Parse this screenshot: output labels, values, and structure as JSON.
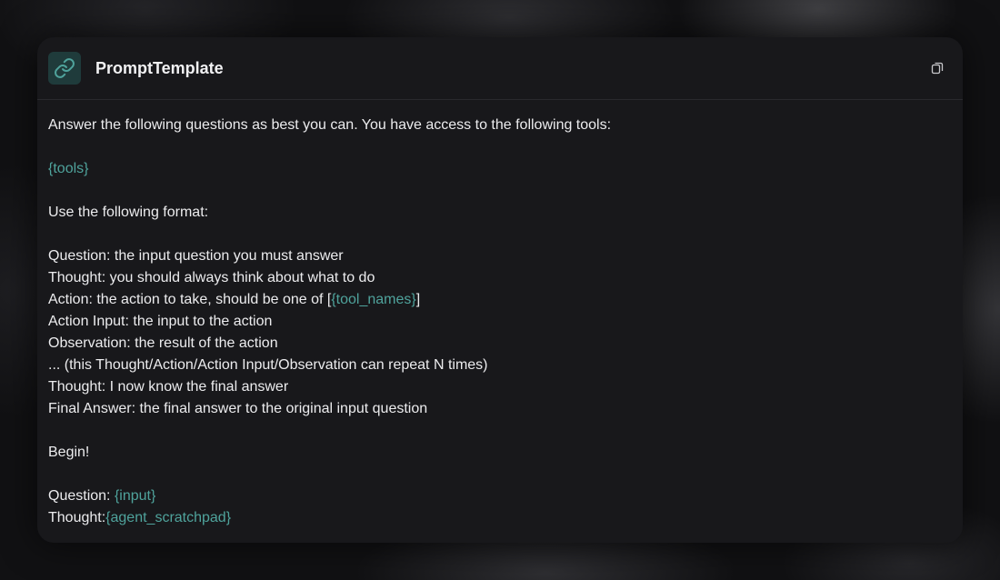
{
  "card": {
    "title": "PromptTemplate",
    "icon": "link-icon",
    "copy_icon": "copy-icon"
  },
  "colors": {
    "variable": "#4fa39c",
    "card_bg": "#18181b",
    "text": "#ececee",
    "icon_tile": "#1f3b3b"
  },
  "prompt": {
    "intro": "Answer the following questions as best you can. You have access to the following tools:",
    "tools_var": "{tools}",
    "format_intro": "Use the following format:",
    "question_line": "Question: the input question you must answer",
    "thought_line": "Thought: you should always think about what to do",
    "action_prefix": "Action: the action to take, should be one of [",
    "tool_names_var": "{tool_names}",
    "action_suffix": "]",
    "action_input_line": "Action Input: the input to the action",
    "observation_line": "Observation: the result of the action",
    "repeat_line": "... (this Thought/Action/Action Input/Observation can repeat N times)",
    "final_thought_line": "Thought: I now know the final answer",
    "final_answer_line": "Final Answer: the final answer to the original input question",
    "begin_line": "Begin!",
    "question_prefix": "Question: ",
    "input_var": "{input}",
    "thought_prefix": "Thought:",
    "scratchpad_var": "{agent_scratchpad}"
  }
}
